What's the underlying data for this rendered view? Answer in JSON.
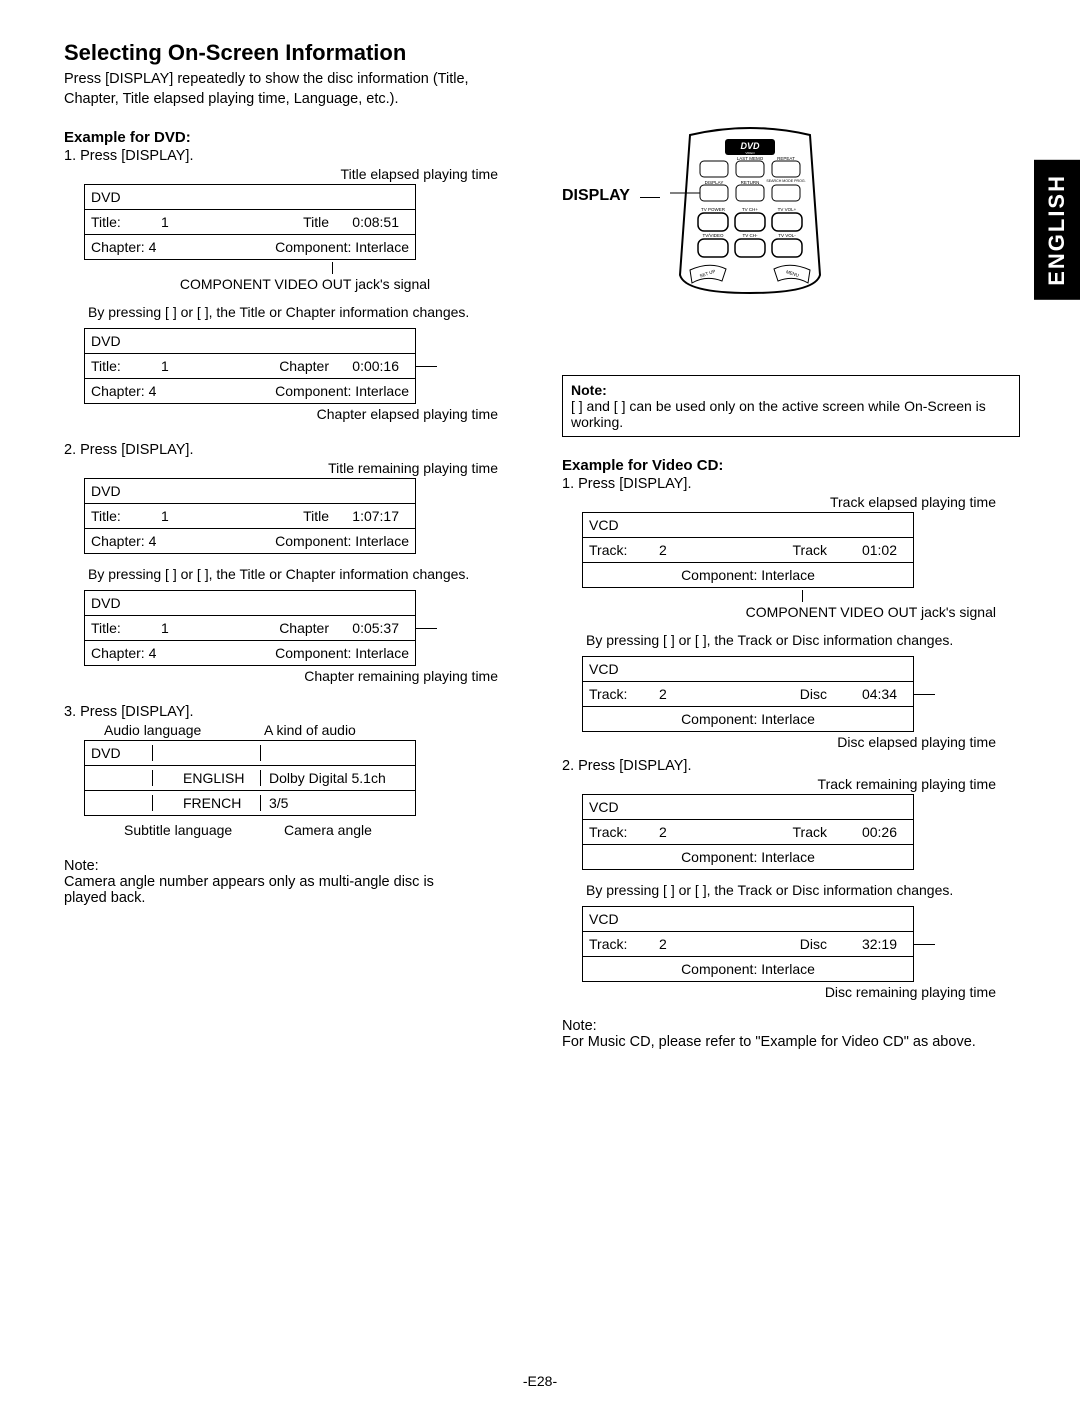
{
  "page": {
    "title": "Selecting On-Screen Information",
    "intro": "Press [DISPLAY] repeatedly to show the disc information (Title, Chapter, Title elapsed playing time, Language, etc.).",
    "language_tab": "ENGLISH",
    "page_number": "-E28-"
  },
  "remote": {
    "label": "DISPLAY",
    "logo": "DVD",
    "logo_sub": "VIDEO",
    "buttons_row1": [
      "",
      "LAST MEMO",
      "REPEAT"
    ],
    "buttons_row2": [
      "DISPLAY",
      "RETURN",
      "SEARCH MODE PROG."
    ],
    "buttons_row3": [
      "TV POWER",
      "TV CH+",
      "TV VOL+"
    ],
    "buttons_row4": [
      "TV/VIDEO",
      "TV CH-",
      "TV VOL-"
    ],
    "bottom_left": "SET UP",
    "bottom_right": "MENU"
  },
  "note_box": {
    "title": "Note:",
    "body": "[    ] and [    ] can be used only on the active screen while On-Screen is working."
  },
  "dvd": {
    "heading": "Example for DVD:",
    "step1": "1.   Press [DISPLAY].",
    "cap1a_top": "Title elapsed playing time",
    "osd1": {
      "disc": "DVD",
      "title_label": "Title:",
      "title_num": "1",
      "mid": "Title",
      "time": "0:08:51",
      "chapter": "Chapter:  4",
      "component": "Component: Interlace"
    },
    "post1": "COMPONENT VIDEO OUT jack's signal",
    "bypress1": "By pressing [    ] or [    ], the Title or Chapter information changes.",
    "osd2": {
      "disc": "DVD",
      "title_label": "Title:",
      "title_num": "1",
      "mid": "Chapter",
      "time": "0:00:16",
      "chapter": "Chapter:  4",
      "component": "Component: Interlace"
    },
    "cap2": "Chapter elapsed playing time",
    "step2": "2.   Press [DISPLAY].",
    "cap3_top": "Title remaining playing time",
    "osd3": {
      "disc": "DVD",
      "title_label": "Title:",
      "title_num": "1",
      "mid": "Title",
      "time": "1:07:17",
      "chapter": "Chapter:  4",
      "component": "Component: Interlace"
    },
    "bypress2": "By pressing [    ] or [    ], the Title or Chapter information changes.",
    "osd4": {
      "disc": "DVD",
      "title_label": "Title:",
      "title_num": "1",
      "mid": "Chapter",
      "time": "0:05:37",
      "chapter": "Chapter:  4",
      "component": "Component: Interlace"
    },
    "cap4": "Chapter remaining playing time",
    "step3": "3.   Press [DISPLAY].",
    "audio_cap_l": "Audio language",
    "audio_cap_r": "A kind of audio",
    "osd5": {
      "disc": "DVD",
      "lang": "ENGLISH",
      "audio": "Dolby Digital 5.1ch",
      "sub": "FRENCH",
      "angle": "3/5"
    },
    "sub_cap_l": "Subtitle language",
    "sub_cap_r": "Camera angle",
    "note_hdr": "Note:",
    "note_body": "Camera angle number appears only as multi-angle disc is played back."
  },
  "vcd": {
    "heading": "Example for Video CD:",
    "step1": "1.   Press [DISPLAY].",
    "cap1_top": "Track elapsed playing time",
    "osd1": {
      "disc": "VCD",
      "track_label": "Track:",
      "track_num": "2",
      "mid": "Track",
      "time": "01:02",
      "component": "Component: Interlace"
    },
    "post1": "COMPONENT VIDEO OUT jack's signal",
    "bypress1": "By pressing [    ] or [    ], the Track or Disc information changes.",
    "osd2": {
      "disc": "VCD",
      "track_label": "Track:",
      "track_num": "2",
      "mid": "Disc",
      "time": "04:34",
      "component": "Component: Interlace"
    },
    "cap2": "Disc elapsed playing time",
    "step2": "2.   Press [DISPLAY].",
    "cap3_top": "Track remaining playing time",
    "osd3": {
      "disc": "VCD",
      "track_label": "Track:",
      "track_num": "2",
      "mid": "Track",
      "time": "00:26",
      "component": "Component: Interlace"
    },
    "bypress2": "By pressing [    ] or [    ], the Track or Disc information changes.",
    "osd4": {
      "disc": "VCD",
      "track_label": "Track:",
      "track_num": "2",
      "mid": "Disc",
      "time": "32:19",
      "component": "Component: Interlace"
    },
    "cap4": "Disc remaining playing time",
    "note_hdr": "Note:",
    "note_body": "For Music CD, please refer to \"Example for Video CD\" as above."
  }
}
